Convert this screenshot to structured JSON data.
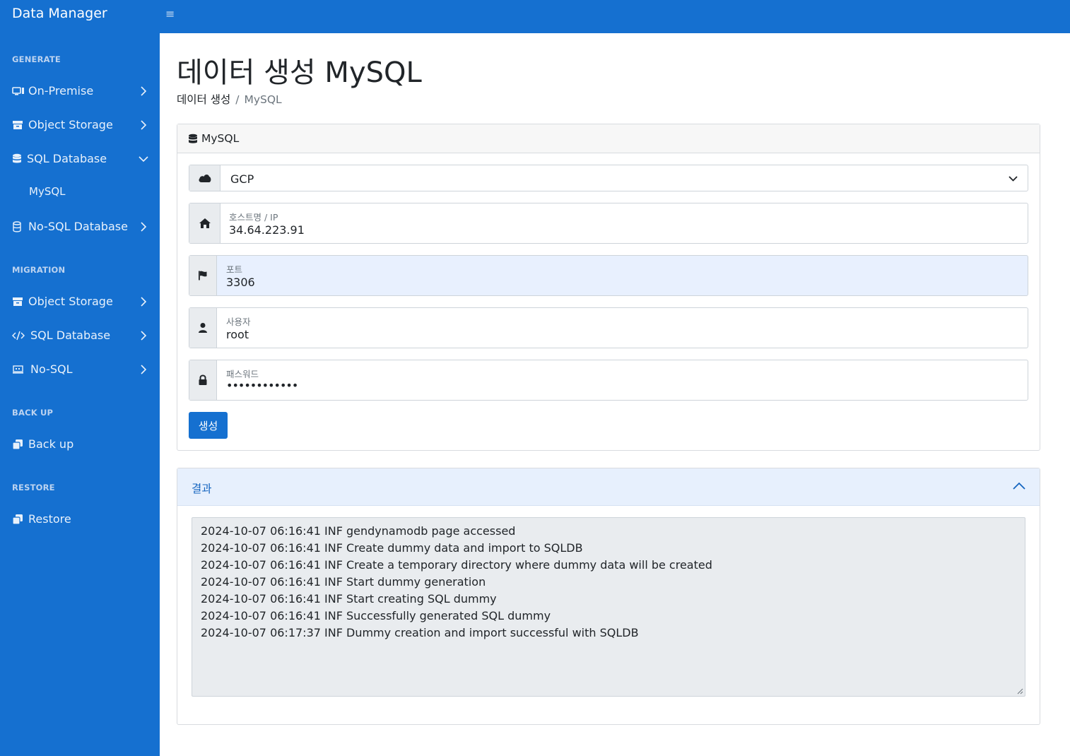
{
  "app": {
    "brand": "Data Manager",
    "menu_icon": "≡"
  },
  "sidebar": {
    "sections": [
      {
        "heading": "GENERATE"
      },
      {
        "heading": "MIGRATION"
      },
      {
        "heading": "BACK UP"
      },
      {
        "heading": "RESTORE"
      }
    ],
    "generate": [
      {
        "label": "On-Premise",
        "icon": "server-icon"
      },
      {
        "label": "Object Storage",
        "icon": "archive-icon"
      },
      {
        "label": "SQL Database",
        "icon": "database-icon",
        "expanded": true,
        "children": [
          "MySQL"
        ]
      },
      {
        "label": "No-SQL Database",
        "icon": "database-outline-icon"
      }
    ],
    "migration": [
      {
        "label": "Object Storage",
        "icon": "archive-icon"
      },
      {
        "label": "SQL Database",
        "icon": "code-icon"
      },
      {
        "label": "No-SQL",
        "icon": "laptop-icon"
      }
    ],
    "backup": [
      {
        "label": "Back up",
        "icon": "copy-icon"
      }
    ],
    "restore": [
      {
        "label": "Restore",
        "icon": "copy-icon"
      }
    ]
  },
  "main": {
    "title": "데이터 생성 MySQL",
    "breadcrumb": {
      "parent": "데이터 생성",
      "separator": "/",
      "current": "MySQL"
    },
    "form_card": {
      "title": "MySQL",
      "provider": {
        "selected": "GCP"
      },
      "fields": {
        "host": {
          "label": "호스트명 / IP",
          "value": "34.64.223.91"
        },
        "port": {
          "label": "포트",
          "value": "3306"
        },
        "user": {
          "label": "사용자",
          "value": "root"
        },
        "password": {
          "label": "패스워드",
          "value": "••••••••••••"
        }
      },
      "submit_label": "생성"
    },
    "result_card": {
      "title": "결과",
      "log_lines": [
        "2024-10-07 06:16:41 INF gendynamodb page accessed",
        "2024-10-07 06:16:41 INF Create dummy data and import to SQLDB",
        "2024-10-07 06:16:41 INF Create a temporary directory where dummy data will be created",
        "2024-10-07 06:16:41 INF Start dummy generation",
        "2024-10-07 06:16:41 INF Start creating SQL dummy",
        "2024-10-07 06:16:41 INF Successfully generated SQL dummy",
        "2024-10-07 06:17:37 INF Dummy creation and import successful with SQLDB"
      ]
    }
  },
  "colors": {
    "brand_blue": "#1570d0",
    "result_header_bg": "#e7f0fd"
  }
}
